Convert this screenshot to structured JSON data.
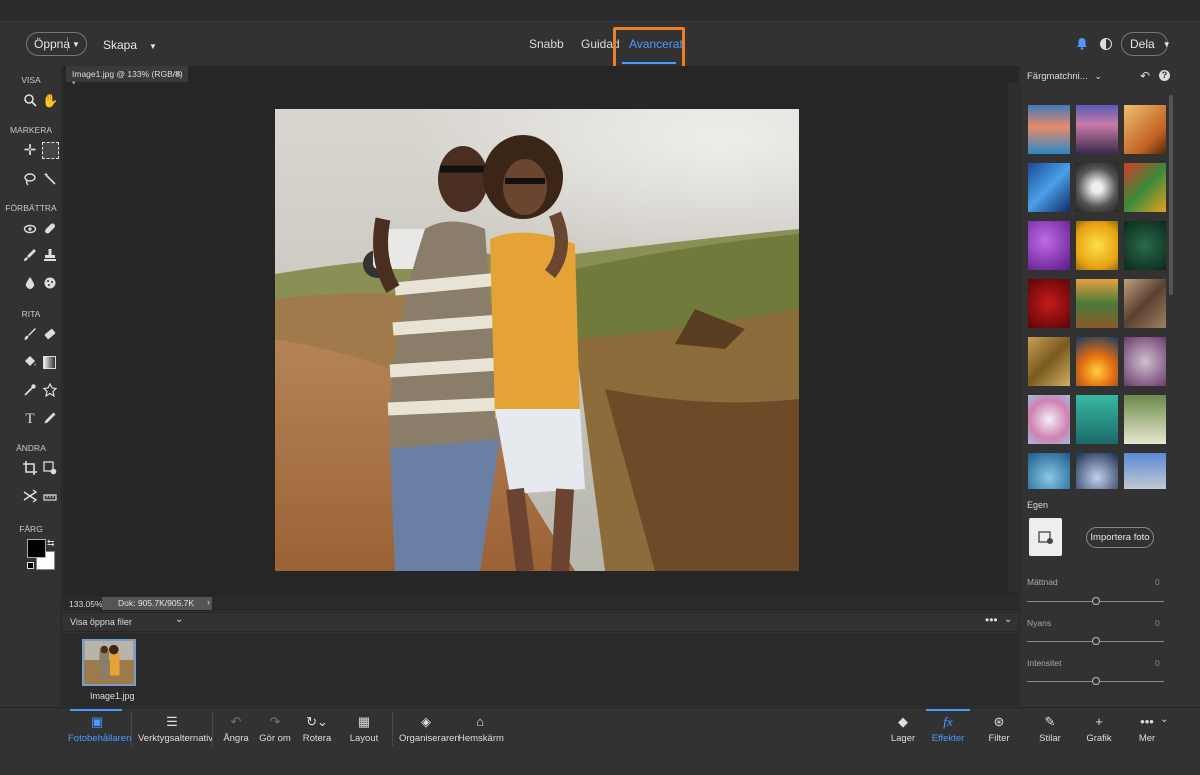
{
  "header": {
    "open_label": "Öppna",
    "create_label": "Skapa",
    "modes": [
      "Snabb",
      "Guidad",
      "Avancerat"
    ],
    "active_mode": "Avancerat",
    "share_label": "Dela"
  },
  "toolbar": {
    "sections": [
      "VISA",
      "MARKERA",
      "FÖRBÄTTRA",
      "RITA",
      "ÄNDRA",
      "FÄRG"
    ],
    "foreground_color": "#000000",
    "background_color": "#ffffff"
  },
  "document": {
    "tab_title": "Image1.jpg @ 133% (RGB/8) *",
    "zoom": "133.05%",
    "doc_info": "Dok: 905.7K/905.7K"
  },
  "bin": {
    "label": "Visa öppna filer",
    "files": [
      "Image1.jpg"
    ]
  },
  "right_panel": {
    "title": "Färgmatchni...",
    "custom_label": "Egen",
    "import_label": "Importera foto",
    "sliders": [
      {
        "label": "Mättnad",
        "value": "0"
      },
      {
        "label": "Nyans",
        "value": "0"
      },
      {
        "label": "Intensitet",
        "value": "0"
      }
    ]
  },
  "bottom_bar": {
    "left": [
      "Fotobehållaren",
      "Verktygsalternativ",
      "Ångra",
      "Gör om",
      "Rotera",
      "Layout",
      "Organiseraren",
      "Hemskärm"
    ],
    "right": [
      "Lager",
      "Effekter",
      "Filter",
      "Stilar",
      "Grafik",
      "Mer"
    ],
    "active_left": "Fotobehållaren",
    "active_right": "Effekter"
  },
  "colors": {
    "accent": "#4a9bff",
    "highlight_box": "#ef7d22"
  }
}
